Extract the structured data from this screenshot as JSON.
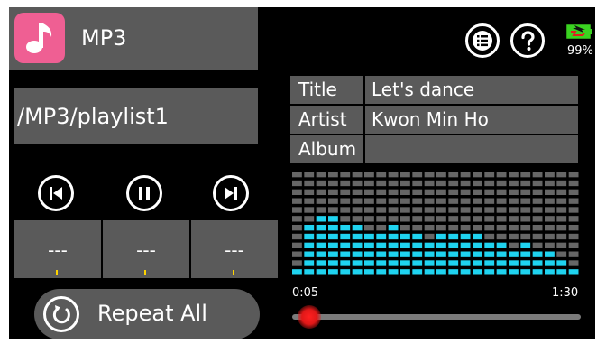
{
  "app": {
    "title": "MP3",
    "icon": "music-note-icon",
    "accent": "#ef5f93"
  },
  "header_buttons": [
    {
      "name": "playlist-menu-button",
      "icon": "list-icon"
    },
    {
      "name": "help-button",
      "icon": "question-icon"
    }
  ],
  "battery": {
    "percent_label": "99%",
    "level": 0.99,
    "color": "#3ad321"
  },
  "path": {
    "value": "/MP3/playlist1"
  },
  "transport": [
    {
      "name": "previous-track-button",
      "icon": "skip-previous-icon"
    },
    {
      "name": "pause-button",
      "icon": "pause-icon"
    },
    {
      "name": "next-track-button",
      "icon": "skip-next-icon"
    }
  ],
  "counters": [
    "---",
    "---",
    "---"
  ],
  "track_info": [
    {
      "key": "Title",
      "value": "Let's dance"
    },
    {
      "key": "Artist",
      "value": "Kwon Min Ho"
    },
    {
      "key": "Album",
      "value": ""
    }
  ],
  "spectrum": {
    "bands": 24,
    "max_segments": 12,
    "levels": [
      1,
      6,
      7,
      7,
      6,
      6,
      5,
      5,
      6,
      5,
      5,
      4,
      5,
      5,
      5,
      5,
      4,
      4,
      3,
      4,
      3,
      3,
      2,
      1
    ],
    "active_color": "#1fd3f0",
    "inactive_color": "#666666"
  },
  "playback": {
    "elapsed": "0:05",
    "total": "1:30",
    "progress": 0.06
  },
  "repeat": {
    "label": "Repeat All",
    "icon": "repeat-icon"
  }
}
